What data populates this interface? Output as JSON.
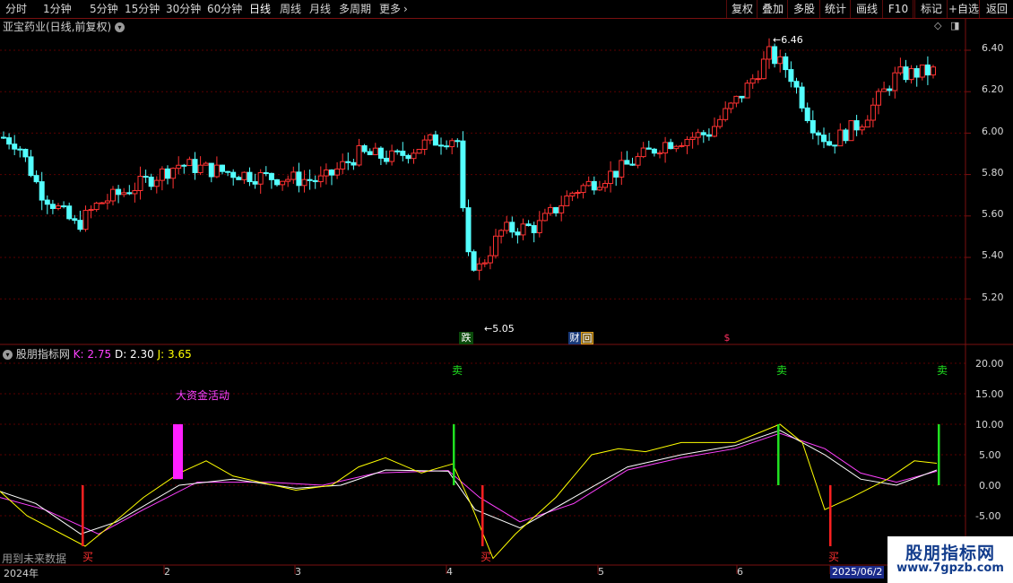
{
  "toolbar": {
    "periods": [
      "分时",
      "1分钟",
      "5分钟",
      "15分钟",
      "30分钟",
      "60分钟",
      "日线",
      "周线",
      "月线",
      "多周期",
      "更多"
    ],
    "active_period": "日线",
    "more_chevron": "›",
    "buttons": [
      "复权",
      "叠加",
      "多股",
      "统计",
      "画线",
      "F10",
      "+自选",
      "返回"
    ]
  },
  "main_chart": {
    "title": "亚宝药业(日线,前复权)",
    "high_label": "6.46",
    "low_label": "5.05",
    "y_ticks": [
      "6.40",
      "6.20",
      "6.00",
      "5.80",
      "5.60",
      "5.40",
      "5.20"
    ],
    "markers": [
      "跌",
      "财",
      "回",
      "$"
    ]
  },
  "indicator": {
    "name": "股朋指标网",
    "k_label": "K: 2.75",
    "d_label": "D: 2.30",
    "j_label": "J: 3.65",
    "y_ticks": [
      "20.00",
      "15.00",
      "10.00",
      "5.00",
      "0.00",
      "-5.00"
    ],
    "big_money_label": "大资金活动",
    "buy_label": "买",
    "sell_label": "卖",
    "future_note": "用到未来数据"
  },
  "x_axis": {
    "labels": [
      "2024年",
      "2",
      "3",
      "4",
      "5",
      "6"
    ],
    "highlight": "2025/06/2"
  },
  "watermark": {
    "line1": "股朋指标网",
    "line2": "www.7gpzb.com"
  },
  "colors": {
    "up": "#ff3232",
    "down": "#54ffff",
    "k_line": "#ffffff",
    "d_line": "#ff40ff",
    "j_line": "#ffff00",
    "buy_bar": "#ff2020",
    "sell_bar": "#20e020",
    "axis": "#7a1010"
  }
}
